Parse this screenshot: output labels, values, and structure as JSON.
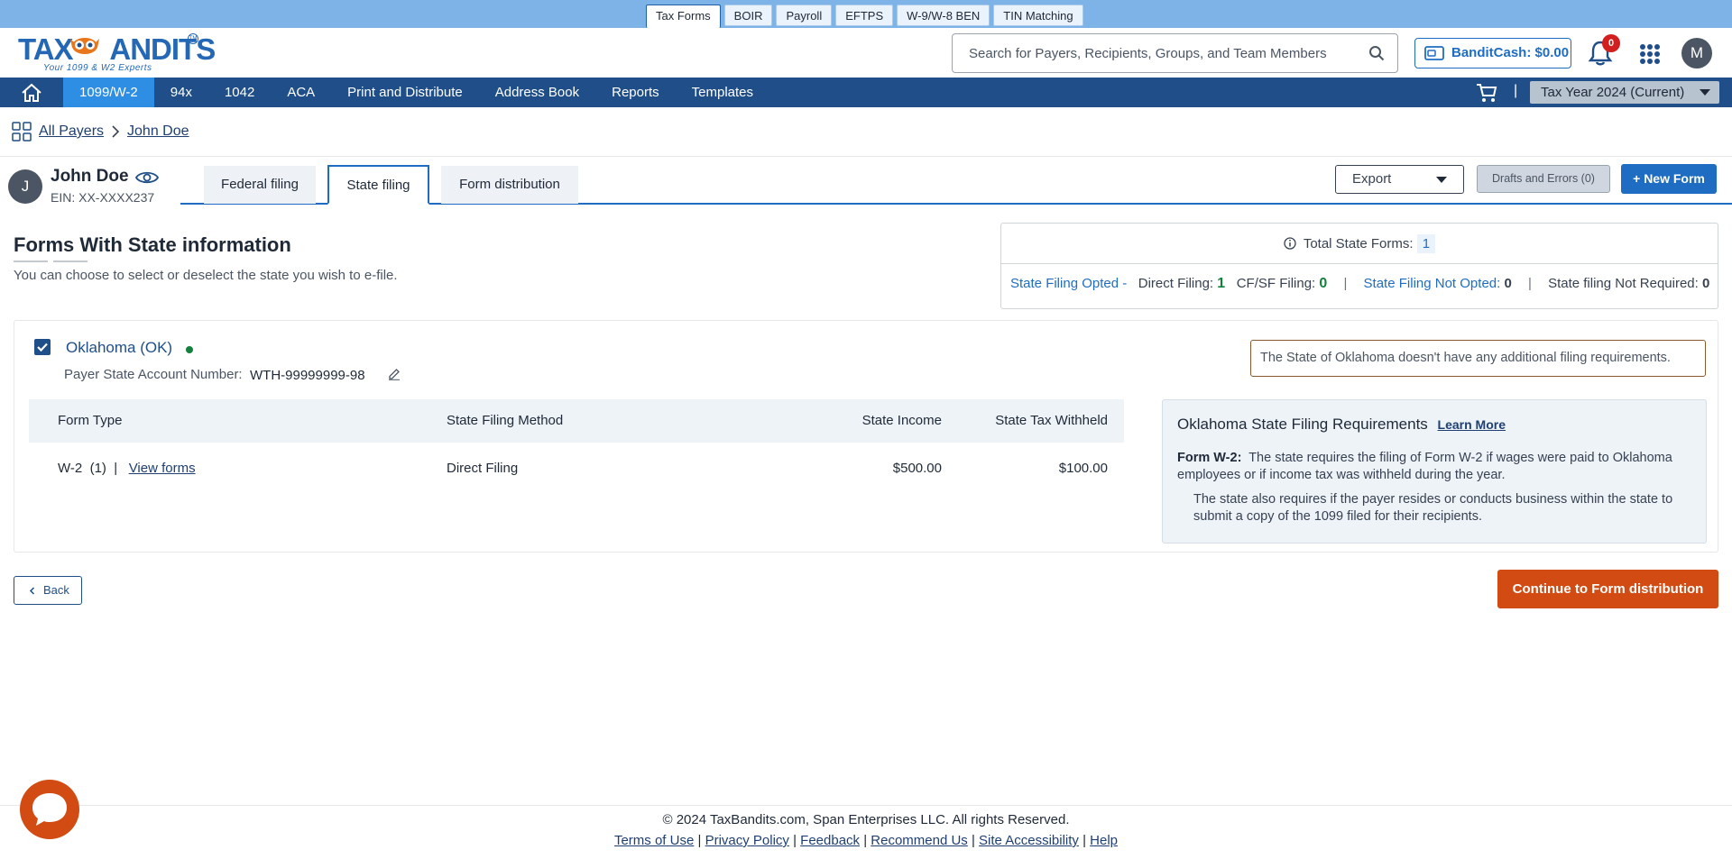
{
  "product_tabs": [
    "Tax Forms",
    "BOIR",
    "Payroll",
    "EFTPS",
    "W-9/W-8 BEN",
    "TIN Matching"
  ],
  "logo": {
    "tagline": "Your 1099 & W2 Experts",
    "trademark": "TM"
  },
  "search": {
    "placeholder": "Search for Payers, Recipients, Groups, and Team Members"
  },
  "bandit_cash": {
    "label": "BanditCash:",
    "amount": "$0.00"
  },
  "notifications": {
    "count": "0"
  },
  "user": {
    "initial": "M"
  },
  "nav": {
    "items": [
      "1099/W-2",
      "94x",
      "1042",
      "ACA",
      "Print and Distribute",
      "Address Book",
      "Reports",
      "Templates"
    ],
    "active": "1099/W-2",
    "tax_year": "Tax Year 2024 (Current)"
  },
  "breadcrumb": {
    "all_payers": "All Payers",
    "payer": "John Doe"
  },
  "payer": {
    "initial": "J",
    "name": "John Doe",
    "ein": "EIN: XX-XXXX237"
  },
  "filing_tabs": {
    "federal": "Federal filing",
    "state": "State filing",
    "distribution": "Form distribution"
  },
  "actions": {
    "export": "Export",
    "drafts": "Drafts and Errors (0)",
    "new_form": "+ New Form"
  },
  "forms_section": {
    "title": "Forms With State information",
    "subtitle": "You can choose to select or deselect the state you wish to e-file."
  },
  "summary": {
    "total_label": "Total State Forms:",
    "total_count": "1",
    "opted_label": "State Filing Opted -",
    "direct_label": "Direct Filing:",
    "direct_count": "1",
    "cfsf_label": "CF/SF Filing:",
    "cfsf_count": "0",
    "not_opted_label": "State Filing Not Opted:",
    "not_opted_count": "0",
    "not_required_label": "State filing Not Required:",
    "not_required_count": "0"
  },
  "state": {
    "name": "Oklahoma (OK)",
    "account_label": "Payer State Account Number:",
    "account_number": "WTH-99999999-98",
    "note": "The State of Oklahoma doesn't have any additional filing requirements.",
    "table": {
      "headers": [
        "Form Type",
        "State Filing Method",
        "State Income",
        "State Tax Withheld"
      ],
      "rows": [
        {
          "form_type": "W-2",
          "count": "(1)",
          "sep": "|",
          "view": "View forms",
          "method": "Direct Filing",
          "income": "$500.00",
          "withheld": "$100.00"
        }
      ]
    },
    "requirements": {
      "title": "Oklahoma State Filing Requirements",
      "learn_more": "Learn More",
      "form_label": "Form W-2:",
      "text1": "The state requires the filing of Form W-2 if wages were paid to Oklahoma employees or if income tax was withheld during the year.",
      "text2": "The state also requires if the payer resides or conducts business within the state to submit a copy of the 1099 filed for their recipients."
    }
  },
  "buttons": {
    "back": "Back",
    "continue": "Continue to Form distribution"
  },
  "footer": {
    "copyright": "© 2024 TaxBandits.com, Span Enterprises LLC. All rights Reserved.",
    "links": [
      "Terms of Use",
      "Privacy Policy",
      "Feedback",
      "Recommend Us",
      "Site Accessibility",
      "Help"
    ]
  },
  "colors": {
    "primary": "#1f6dc2",
    "nav": "#1f4e88",
    "accent": "#d14b12",
    "success": "#15803d"
  }
}
